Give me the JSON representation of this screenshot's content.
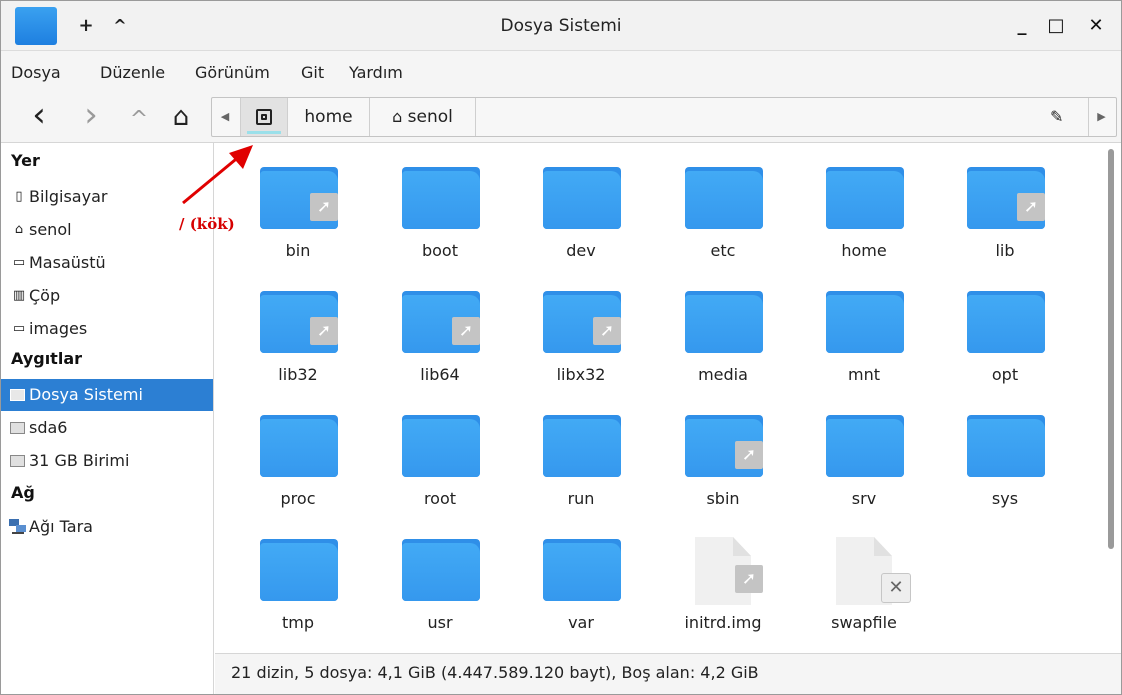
{
  "window": {
    "title": "Dosya Sistemi",
    "titlebar_buttons": {
      "new": "+",
      "up": "^"
    },
    "controls": {
      "minimize": "_",
      "maximize": "□",
      "close": "✕"
    }
  },
  "menu": [
    "Dosya",
    "Düzenle",
    "Görünüm",
    "Git",
    "Yardım"
  ],
  "toolbar": {
    "back": "‹",
    "forward": "›",
    "up": "^",
    "home": "⌂"
  },
  "pathbar": {
    "crumbs": [
      {
        "label": ""
      },
      {
        "label": "home"
      },
      {
        "label": "senol",
        "icon": "home-icon"
      }
    ]
  },
  "sidebar": {
    "sections": [
      {
        "header": "Yer",
        "items": [
          {
            "label": "Bilgisayar",
            "icon": "computer-icon"
          },
          {
            "label": "senol",
            "icon": "home-icon"
          },
          {
            "label": "Masaüstü",
            "icon": "desktop-icon"
          },
          {
            "label": "Çöp",
            "icon": "trash-icon"
          },
          {
            "label": "images",
            "icon": "folder-icon"
          }
        ]
      },
      {
        "header": "Aygıtlar",
        "items": [
          {
            "label": "Dosya Sistemi",
            "icon": "drive-icon",
            "selected": true
          },
          {
            "label": "sda6",
            "icon": "drive-icon"
          },
          {
            "label": "31 GB Birimi",
            "icon": "drive-icon"
          }
        ]
      },
      {
        "header": "Ağ",
        "items": [
          {
            "label": "Ağı Tara",
            "icon": "network-icon"
          }
        ]
      }
    ]
  },
  "files": [
    {
      "name": "bin",
      "type": "folder",
      "symlink": true
    },
    {
      "name": "boot",
      "type": "folder",
      "symlink": false
    },
    {
      "name": "dev",
      "type": "folder",
      "symlink": false
    },
    {
      "name": "etc",
      "type": "folder",
      "symlink": false
    },
    {
      "name": "home",
      "type": "folder",
      "symlink": false
    },
    {
      "name": "lib",
      "type": "folder",
      "symlink": true
    },
    {
      "name": "lib32",
      "type": "folder",
      "symlink": true
    },
    {
      "name": "lib64",
      "type": "folder",
      "symlink": true
    },
    {
      "name": "libx32",
      "type": "folder",
      "symlink": true
    },
    {
      "name": "media",
      "type": "folder",
      "symlink": false
    },
    {
      "name": "mnt",
      "type": "folder",
      "symlink": false
    },
    {
      "name": "opt",
      "type": "folder",
      "symlink": false
    },
    {
      "name": "proc",
      "type": "folder",
      "symlink": false
    },
    {
      "name": "root",
      "type": "folder",
      "symlink": false
    },
    {
      "name": "run",
      "type": "folder",
      "symlink": false
    },
    {
      "name": "sbin",
      "type": "folder",
      "symlink": true
    },
    {
      "name": "srv",
      "type": "folder",
      "symlink": false
    },
    {
      "name": "sys",
      "type": "folder",
      "symlink": false
    },
    {
      "name": "tmp",
      "type": "folder",
      "symlink": false
    },
    {
      "name": "usr",
      "type": "folder",
      "symlink": false
    },
    {
      "name": "var",
      "type": "folder",
      "symlink": false
    },
    {
      "name": "initrd.img",
      "type": "file",
      "symlink": true
    },
    {
      "name": "swapfile",
      "type": "file",
      "symlink": false,
      "broken": true
    }
  ],
  "status": "21 dizin, 5 dosya: 4,1 GiB (4.447.589.120 bayt), Boş alan: 4,2 GiB",
  "annotation": {
    "label": "/ (kök)",
    "color": "#d60000"
  },
  "colors": {
    "accent": "#2c7fd3",
    "folder": "#3a9ef0"
  }
}
